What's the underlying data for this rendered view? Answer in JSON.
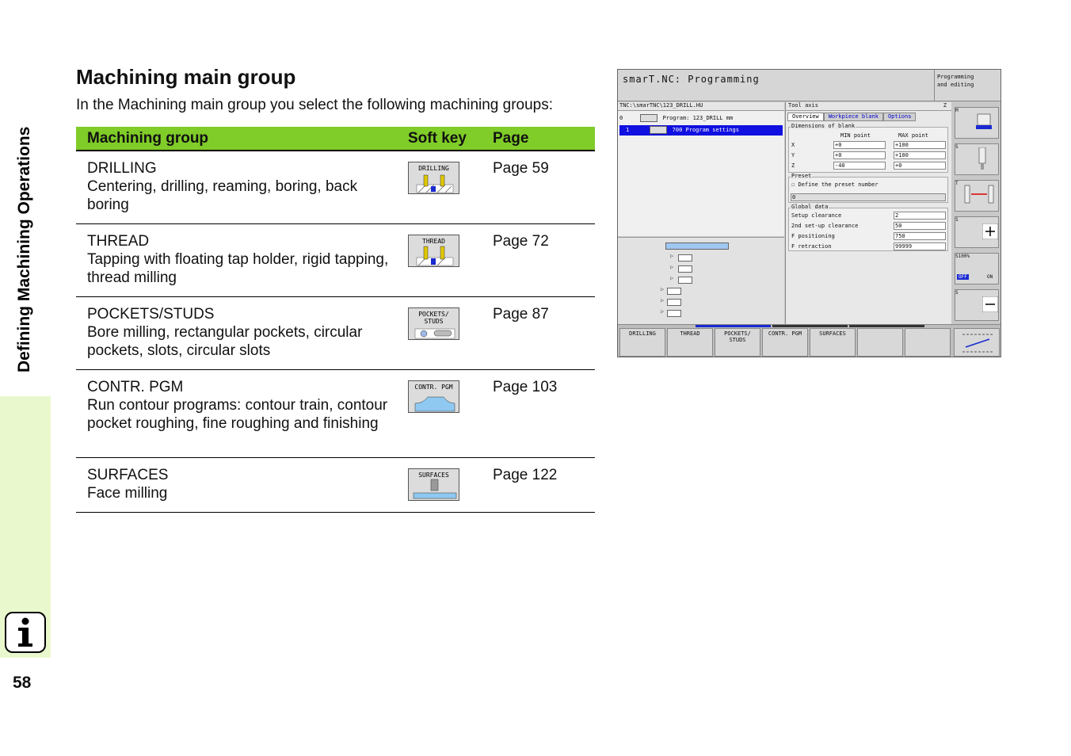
{
  "sidebar": {
    "title": "Defining Machining Operations",
    "page_number": "58",
    "info_icon": "info-icon"
  },
  "heading": "Machining main group",
  "intro": "In the Machining main group you select the following machining groups:",
  "table": {
    "headers": [
      "Machining group",
      "Soft key",
      "Page"
    ],
    "rows": [
      {
        "name": "DRILLING",
        "desc": "Centering, drilling, reaming, boring, back boring",
        "softkey": "DRILLING",
        "page": "Page 59"
      },
      {
        "name": "THREAD",
        "desc": "Tapping with floating tap holder, rigid tapping, thread milling",
        "softkey": "THREAD",
        "page": "Page 72"
      },
      {
        "name": "POCKETS/STUDS",
        "desc": "Bore milling, rectangular pockets, circular pockets, slots, circular slots",
        "softkey": "POCKETS/\nSTUDS",
        "page": "Page 87"
      },
      {
        "name": "CONTR. PGM",
        "desc": "Run contour programs: contour train, contour pocket roughing, fine roughing and finishing",
        "softkey": "CONTR. PGM",
        "page": "Page 103"
      },
      {
        "name": "SURFACES",
        "desc": "Face milling",
        "softkey": "SURFACES",
        "page": "Page 122"
      }
    ]
  },
  "screen": {
    "title": "smarT.NC: Programming",
    "mode": "Programming\nand editing",
    "path": "TNC:\\smarTNC\\123_DRILL.HU",
    "tree": [
      {
        "index": "0",
        "label": "Program: 123_DRILL mm"
      },
      {
        "index": "1",
        "label": "700 Program settings"
      }
    ],
    "form_header": "Tool axis",
    "form_header_value": "Z",
    "tabs": [
      "Overview",
      "Workpiece blank",
      "Options"
    ],
    "blank": {
      "label": "Dimensions of blank",
      "min_label": "MIN point",
      "max_label": "MAX point",
      "rows": [
        {
          "axis": "X",
          "min": "+0",
          "max": "+100"
        },
        {
          "axis": "Y",
          "min": "+0",
          "max": "+100"
        },
        {
          "axis": "Z",
          "min": "-40",
          "max": "+0"
        }
      ]
    },
    "preset": {
      "label": "Preset",
      "checkbox": "Define the preset number",
      "value": "0"
    },
    "global": {
      "label": "Global data",
      "rows": [
        {
          "name": "Setup clearance",
          "value": "2"
        },
        {
          "name": "2nd set-up clearance",
          "value": "50"
        },
        {
          "name": "F positioning",
          "value": "750"
        },
        {
          "name": "F retraction",
          "value": "99999"
        }
      ]
    },
    "right_keys": [
      "M",
      "S",
      "T",
      "S",
      "S100%",
      "S"
    ],
    "s100_off": "OFF",
    "s100_on": "ON",
    "bottom_keys": [
      "DRILLING",
      "THREAD",
      "POCKETS/\nSTUDS",
      "CONTR. PGM",
      "SURFACES"
    ]
  }
}
